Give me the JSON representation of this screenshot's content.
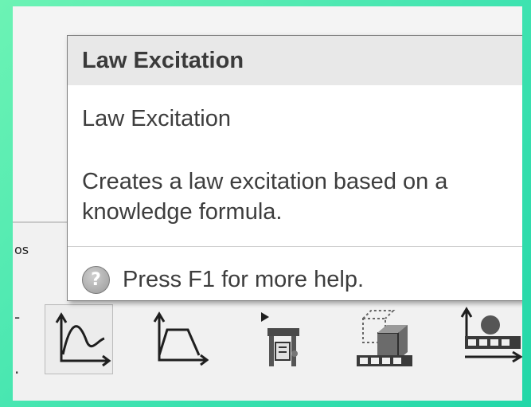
{
  "tooltip": {
    "title": "Law Excitation",
    "name": "Law Excitation",
    "description": "Creates a law excitation based on a knowledge formula.",
    "help_text": "Press F1 for more help.",
    "help_icon": "?"
  },
  "toolbar": {
    "partial_tab_label": "os",
    "items": [
      {
        "icon": "law-excitation-icon",
        "active": true
      },
      {
        "icon": "trapezoid-law-icon",
        "active": false
      },
      {
        "icon": "machine-fixture-icon",
        "active": false
      },
      {
        "icon": "object-on-conveyor-icon",
        "active": false
      },
      {
        "icon": "ball-on-conveyor-icon",
        "active": false
      }
    ]
  },
  "colors": {
    "background_gradient": "#3fe3b0",
    "tooltip_header": "#e8e8e8",
    "text": "#3d3d3d"
  }
}
